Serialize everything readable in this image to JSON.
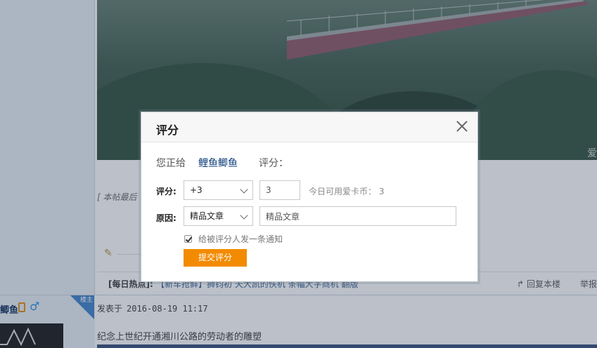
{
  "background": {
    "photo_corner_text": "爱",
    "edited_note": "[ 本帖最后",
    "hot_label": "[每日热点]:",
    "hot_link": "【新车抢鲜】狮钧初 天大凯的佚机 条幅大字商机 翻版",
    "reply_label": "回复本楼",
    "report_label": "举报",
    "next_post": {
      "user_name": "鲫鱼",
      "corner_tag": "楼主",
      "posted_label": "发表于",
      "posted_time": "2016-08-19 11:17",
      "body": "纪念上世纪开通湘川公路的劳动者的雕塑",
      "watermark": "爱卡汽车"
    }
  },
  "dialog": {
    "title": "评分",
    "give_prefix": "您正给",
    "target_user": "鲤鱼鲫鱼",
    "score_prefix": "评分：",
    "score_label": "评分:",
    "score_value": "+3",
    "score_input": "3",
    "available_text": "今日可用爱卡币：",
    "available_count": "3",
    "reason_label": "原因:",
    "reason_value": "精品文章",
    "reason_input": "精品文章",
    "notify_label": "给被评分人发一条通知",
    "notify_checked": true,
    "submit_label": "提交评分"
  },
  "colors": {
    "accent_orange": "#f38b00",
    "link_blue": "#0a3b7a"
  }
}
